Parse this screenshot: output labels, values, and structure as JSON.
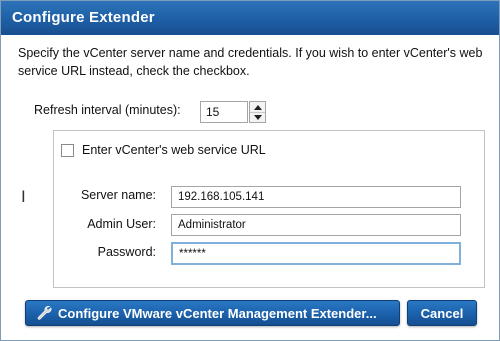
{
  "dialog": {
    "title": "Configure Extender",
    "description": "Specify the vCenter server name and credentials. If you wish to enter vCenter's web service URL instead, check the checkbox."
  },
  "refresh": {
    "label": "Refresh interval (minutes):",
    "value": "15"
  },
  "url_checkbox": {
    "label": "Enter vCenter's web service URL",
    "checked": false
  },
  "fields": {
    "server_name": {
      "label": "Server name:",
      "value": "192.168.105.141"
    },
    "admin_user": {
      "label": "Admin User:",
      "value": "Administrator"
    },
    "password": {
      "label": "Password:",
      "value": "******"
    }
  },
  "buttons": {
    "configure_label": "Configure VMware vCenter Management Extender...",
    "cancel_label": "Cancel"
  },
  "colors": {
    "titlebar": "#1e5fa6",
    "button": "#1a5ea8",
    "focus_border": "#7fb1dc"
  },
  "icons": {
    "configure": "wrench-icon",
    "spin_up": "triangle-up-icon",
    "spin_down": "triangle-down-icon"
  }
}
